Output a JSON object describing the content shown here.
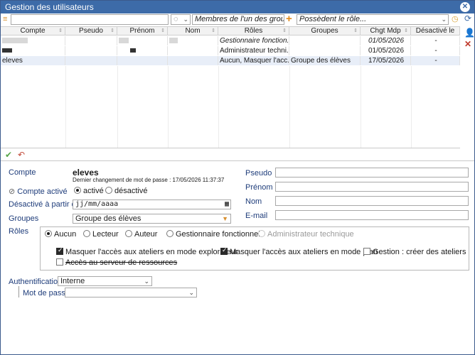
{
  "window": {
    "title": "Gestion des utilisateurs"
  },
  "filters": {
    "search_value": "",
    "groups_filter": "Membres de l'un des groupes...",
    "roles_filter": "Possèdent le rôle..."
  },
  "grid": {
    "columns": [
      "Compte",
      "Pseudo",
      "Prénom",
      "Nom",
      "Rôles",
      "Groupes",
      "Chgt Mdp",
      "Désactivé le"
    ],
    "rows": [
      {
        "roles": "Gestionnaire fonction...",
        "groups": "",
        "chgt": "01/05/2026",
        "desactive": "-"
      },
      {
        "roles": "Administrateur techni...",
        "groups": "",
        "chgt": "01/05/2026",
        "desactive": "-"
      },
      {
        "compte": "eleves",
        "roles": "Aucun, Masquer l'acc...",
        "groups": "Groupe des élèves",
        "chgt": "17/05/2026",
        "desactive": "-"
      }
    ]
  },
  "form": {
    "compte_label": "Compte",
    "compte_value": "eleves",
    "last_change": "Dernier changement de mot de passe : 17/05/2026 11:37:37",
    "compte_actif_label": "Compte activé",
    "active_option": "activé",
    "inactive_option": "désactivé",
    "desactive_label": "Désactivé à partir du",
    "date_placeholder": "jj/mm/aaaa",
    "groupes_label": "Groupes",
    "groupes_value": "Groupe des élèves",
    "roles_label": "Rôles",
    "role_options": [
      "Aucun",
      "Lecteur",
      "Auteur",
      "Gestionnaire fonctionnel",
      "Administrateur technique"
    ],
    "checkboxes": [
      "Masquer l'accès aux ateliers en mode explorateur",
      "Masquer l'accès aux ateliers en mode plan",
      "Gestion : créer des ateliers",
      "Accès au serveur de ressources"
    ],
    "pseudo_label": "Pseudo",
    "prenom_label": "Prénom",
    "nom_label": "Nom",
    "email_label": "E-mail",
    "auth_label": "Authentification",
    "auth_value": "Interne",
    "password_label": "Mot de passe",
    "password_value": ""
  },
  "colors": {
    "titlebar": "#3d6ba8",
    "label": "#1e3c7a",
    "accent": "#e08a1c"
  }
}
